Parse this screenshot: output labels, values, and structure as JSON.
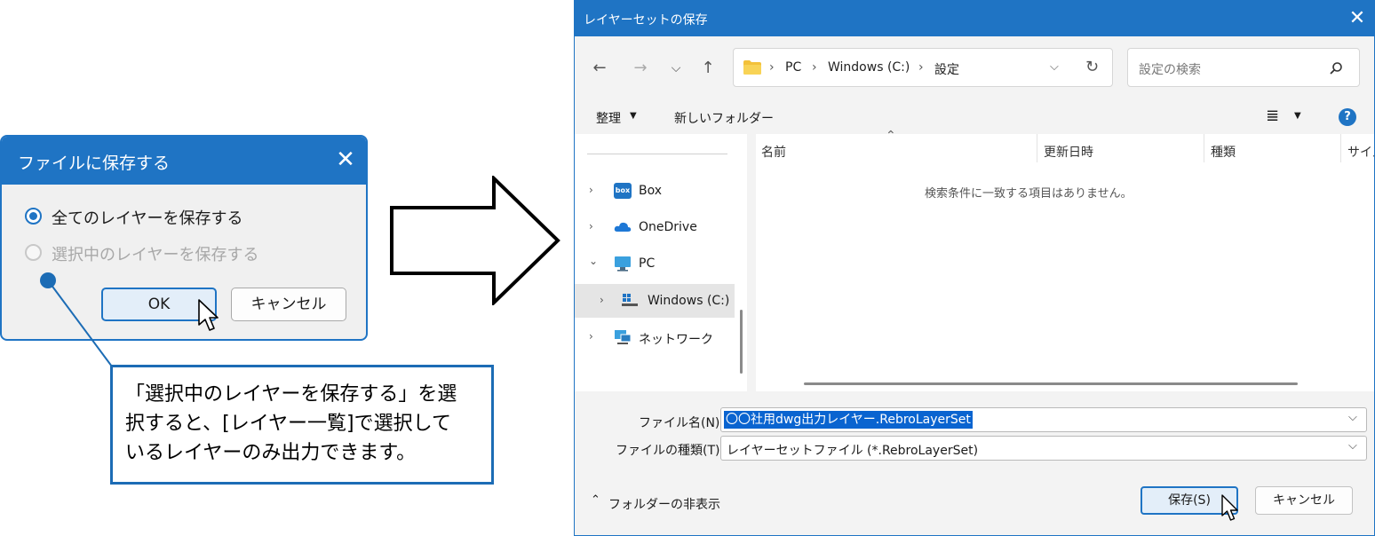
{
  "small_dialog": {
    "title": "ファイルに保存する",
    "close_glyph": "✕",
    "option_all": "全てのレイヤーを保存する",
    "option_selected": "選択中のレイヤーを保存する",
    "ok_label": "OK",
    "cancel_label": "キャンセル"
  },
  "callout": {
    "line1": "「選択中のレイヤーを保存する」を選",
    "line2": "択すると、[レイヤー一覧]で選択して",
    "line3": "いるレイヤーのみ出力できます。"
  },
  "save_dialog": {
    "title": "レイヤーセットの保存",
    "close_glyph": "✕",
    "breadcrumb": [
      "PC",
      "Windows (C:)",
      "設定"
    ],
    "search_placeholder": "設定の検索",
    "toolbar": {
      "organize": "整理",
      "new_folder": "新しいフォルダー"
    },
    "nav_items": [
      {
        "label": "Box",
        "icon": "box-icon"
      },
      {
        "label": "OneDrive",
        "icon": "cloud-icon"
      },
      {
        "label": "PC",
        "icon": "monitor-icon"
      },
      {
        "label": "Windows (C:)",
        "icon": "drive-icon"
      },
      {
        "label": "ネットワーク",
        "icon": "network-icon"
      }
    ],
    "columns": [
      "名前",
      "更新日時",
      "種類",
      "サイズ"
    ],
    "empty_message": "検索条件に一致する項目はありません。",
    "filename_label": "ファイル名(N):",
    "filename_value": "〇〇社用dwg出力レイヤー.RebroLayerSet",
    "filetype_label": "ファイルの種類(T):",
    "filetype_value": "レイヤーセットファイル (*.RebroLayerSet)",
    "hide_folders": "フォルダーの非表示",
    "save_label": "保存(S)",
    "cancel_label": "キャンセル"
  },
  "colors": {
    "accent": "#1f74c4",
    "callout_border": "#1c6cb5"
  }
}
